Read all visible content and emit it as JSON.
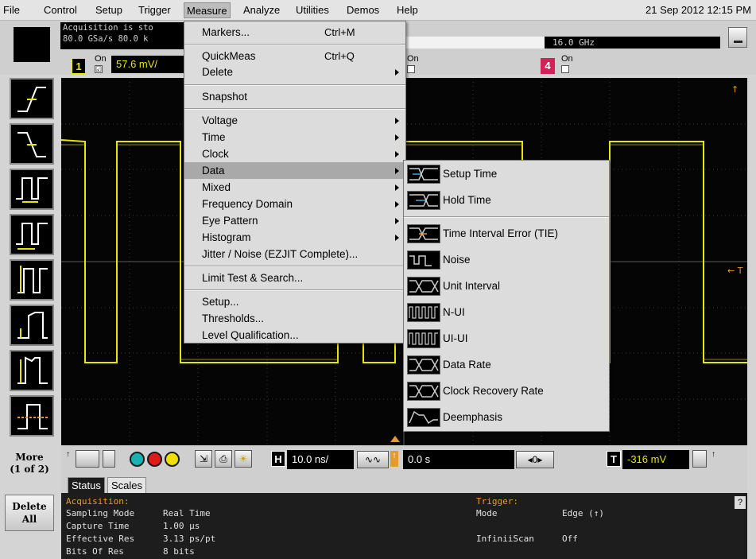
{
  "menubar": {
    "items": [
      "File",
      "Control",
      "Setup",
      "Trigger",
      "Measure",
      "Analyze",
      "Utilities",
      "Demos",
      "Help"
    ],
    "datetime": "21 Sep 2012 12:15 PM"
  },
  "acquisition_box": {
    "line1": "Acquisition is sto",
    "line2": "80.0 GSa/s   80.0 k"
  },
  "bandwidth": "16.0 GHz",
  "channels": {
    "ch1": {
      "num": "1",
      "on_label": "On",
      "checked": "☑",
      "scale": "57.6 mV/",
      "color": "#e6e600"
    },
    "ch4": {
      "num": "4",
      "on_label": "On",
      "color": "#d6205a"
    },
    "ch3_on_label": "On"
  },
  "measure_menu": {
    "items": [
      {
        "label": "Markers...",
        "accel": "Ctrl+M"
      },
      {
        "label": "QuickMeas",
        "accel": "Ctrl+Q"
      },
      {
        "label": "Delete"
      },
      {
        "label": "Snapshot"
      },
      {
        "label": "Voltage"
      },
      {
        "label": "Time"
      },
      {
        "label": "Clock"
      },
      {
        "label": "Data"
      },
      {
        "label": "Mixed"
      },
      {
        "label": "Frequency Domain"
      },
      {
        "label": "Eye Pattern"
      },
      {
        "label": "Histogram"
      },
      {
        "label": "Jitter / Noise (EZJIT Complete)..."
      },
      {
        "label": "Limit Test & Search..."
      },
      {
        "label": "Setup..."
      },
      {
        "label": "Thresholds..."
      },
      {
        "label": "Level Qualification..."
      }
    ]
  },
  "data_submenu": {
    "items": [
      {
        "label": "Setup Time",
        "icon": "setup-time-icon"
      },
      {
        "label": "Hold Time",
        "icon": "hold-time-icon"
      },
      {
        "label": "Time Interval Error (TIE)",
        "icon": "tie-icon"
      },
      {
        "label": "Noise",
        "icon": "noise-icon"
      },
      {
        "label": "Unit Interval",
        "icon": "unit-interval-icon"
      },
      {
        "label": "N-UI",
        "icon": "n-ui-icon"
      },
      {
        "label": "UI-UI",
        "icon": "ui-ui-icon"
      },
      {
        "label": "Data Rate",
        "icon": "data-rate-icon"
      },
      {
        "label": "Clock Recovery Rate",
        "icon": "clock-recovery-rate-icon"
      },
      {
        "label": "Deemphasis",
        "icon": "deemphasis-icon"
      }
    ]
  },
  "left_toolbar": {
    "more_label": "More\n(1 of 2)",
    "more_line1": "More",
    "more_line2": "(1 of 2)",
    "delete_line1": "Delete",
    "delete_line2": "All"
  },
  "controls": {
    "horizontal_chip": "H",
    "timebase": "10.0 ns/",
    "delay": "0.0 s",
    "trigger_chip": "T",
    "trigger_level": "-316 mV",
    "zoom_digit": "0"
  },
  "tabs": {
    "status": "Status",
    "scales": "Scales"
  },
  "status_panel": {
    "acq_heading": "Acquisition:",
    "rows": [
      {
        "key": "Sampling Mode",
        "val": "Real Time"
      },
      {
        "key": "Capture Time",
        "val": "1.00 µs"
      },
      {
        "key": "Effective Res",
        "val": "3.13 ps/pt"
      },
      {
        "key": "Bits Of Res",
        "val": "8 bits"
      }
    ],
    "trig_heading": "Trigger:",
    "trig_rows": [
      {
        "key": "Mode",
        "val": "Edge (↑)"
      },
      {
        "key": "InfiniiScan",
        "val": "Off"
      }
    ],
    "help": "?"
  },
  "colors": {
    "trace": "#e6e600",
    "orange": "#e69a2e"
  }
}
